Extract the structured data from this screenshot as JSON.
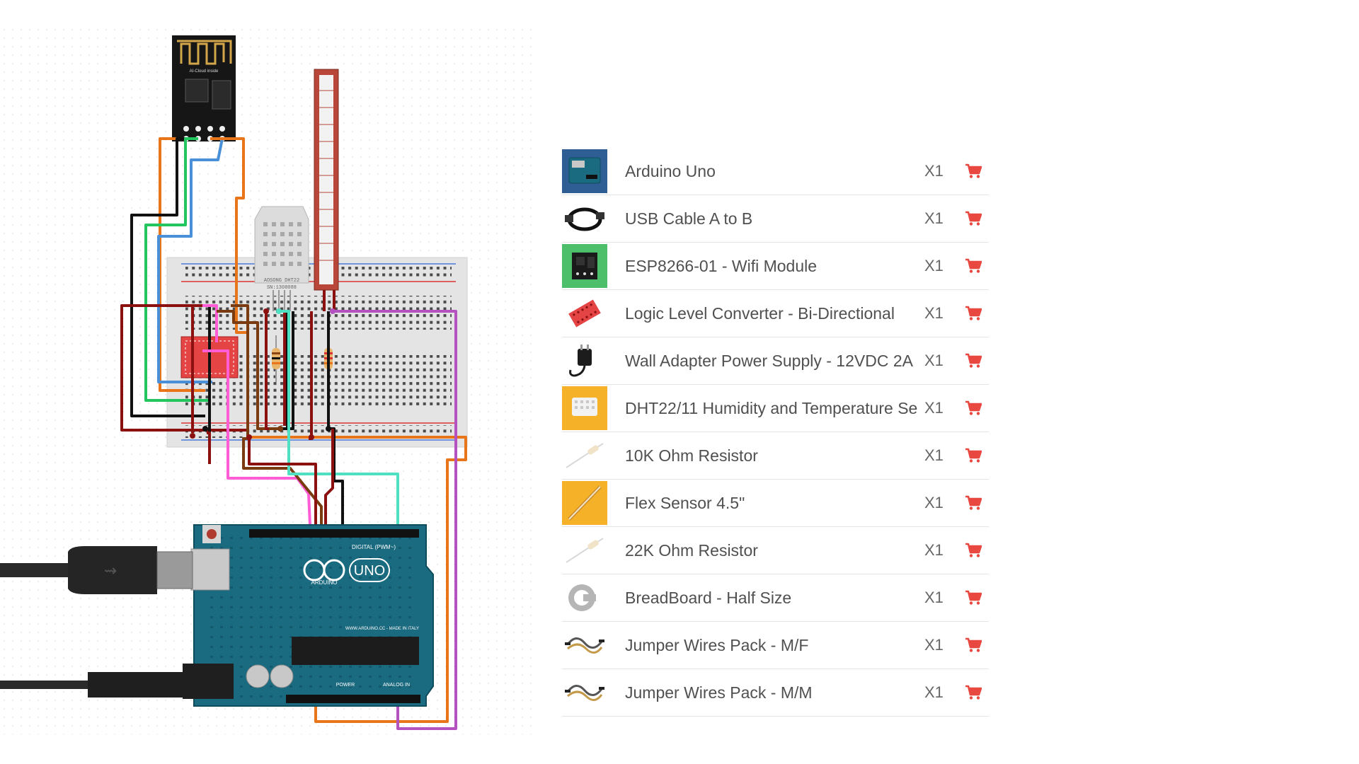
{
  "parts": [
    {
      "name": "Arduino Uno",
      "qty": "X1",
      "thumb": "arduino-uno-icon"
    },
    {
      "name": "USB Cable A to B",
      "qty": "X1",
      "thumb": "usb-cable-icon"
    },
    {
      "name": "ESP8266-01 - Wifi Module",
      "qty": "X1",
      "thumb": "esp8266-icon"
    },
    {
      "name": "Logic Level Converter - Bi-Directional",
      "qty": "X1",
      "thumb": "logic-level-converter-icon"
    },
    {
      "name": "Wall Adapter Power Supply - 12VDC 2A",
      "qty": "X1",
      "thumb": "wall-adapter-icon"
    },
    {
      "name": "DHT22/11 Humidity and Temperature Se",
      "qty": "X1",
      "thumb": "dht22-sensor-icon"
    },
    {
      "name": "10K Ohm Resistor",
      "qty": "X1",
      "thumb": "resistor-icon"
    },
    {
      "name": "Flex Sensor 4.5\"",
      "qty": "X1",
      "thumb": "flex-sensor-icon"
    },
    {
      "name": "22K Ohm Resistor",
      "qty": "X1",
      "thumb": "resistor-icon"
    },
    {
      "name": "BreadBoard - Half Size",
      "qty": "X1",
      "thumb": "breadboard-logo-icon"
    },
    {
      "name": "Jumper Wires Pack - M/F",
      "qty": "X1",
      "thumb": "jumper-wires-icon"
    },
    {
      "name": "Jumper Wires Pack - M/M",
      "qty": "X1",
      "thumb": "jumper-wires-icon"
    }
  ],
  "diagram": {
    "dht_label": "AOSONG DHT22",
    "dht_serial": "SN:1308088",
    "esp_label": "AI-Cloud inside",
    "arduino_brand": "ARDUINO",
    "arduino_model": "UNO",
    "arduino_digital": "DIGITAL (PWM~)",
    "arduino_analog": "ANALOG IN",
    "arduino_power": "POWER",
    "arduino_site": "WWW.ARDUINO.CC - MADE IN ITALY"
  },
  "colors": {
    "cart": "#e8483f",
    "wire_orange": "#e8751a",
    "wire_black": "#111111",
    "wire_green": "#22c55e",
    "wire_blue": "#4a90d9",
    "wire_darkred": "#8b1010",
    "wire_pink": "#ff5cd6",
    "wire_brown": "#7a3b10",
    "wire_teal": "#4ee0c0",
    "wire_purple": "#b452c0",
    "arduino_board": "#1a6a80",
    "breadboard": "#e2e2e2"
  }
}
